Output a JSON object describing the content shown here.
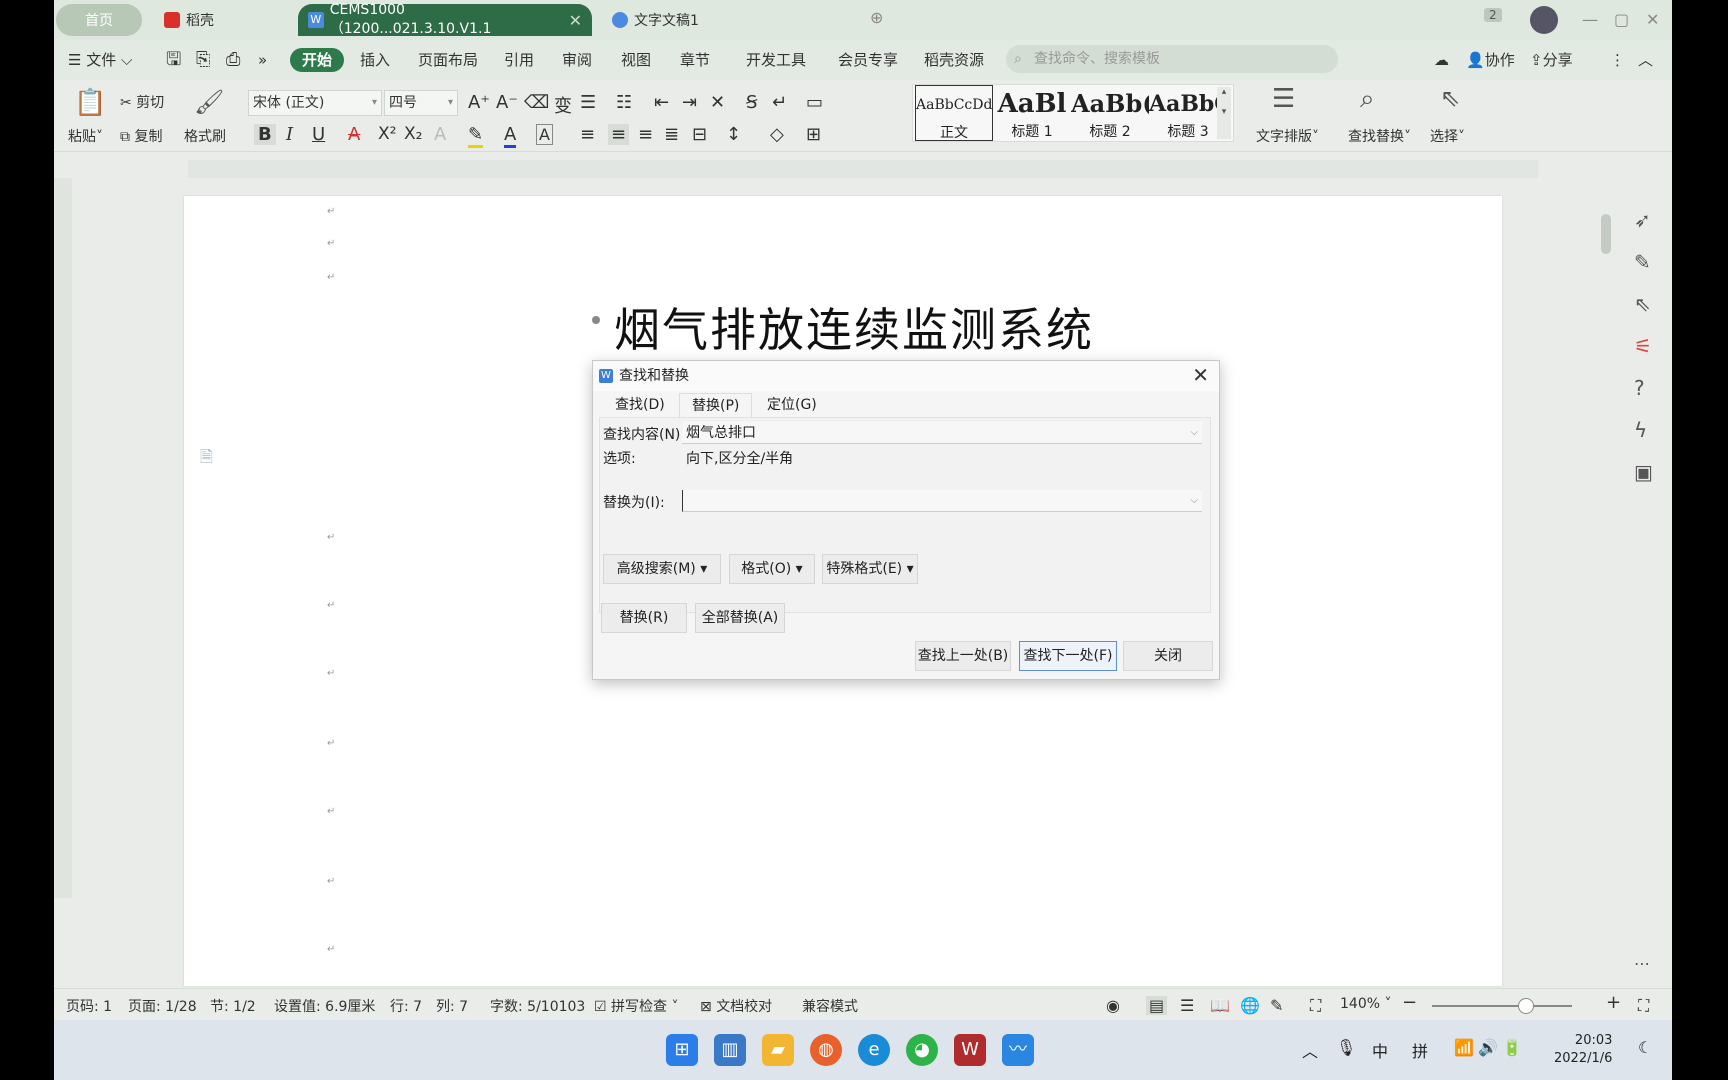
{
  "titlebar": {
    "home_tab": "首页",
    "app_tab": "稻壳",
    "doc_tab_active": "CEMS1000（1200...021.3.10.V1.1",
    "doc_tab_2": "文字文稿1",
    "badge": "2"
  },
  "menubar": {
    "file": "文件",
    "items": [
      "开始",
      "插入",
      "页面布局",
      "引用",
      "审阅",
      "视图",
      "章节",
      "开发工具",
      "会员专享",
      "稻壳资源"
    ],
    "search_placeholder": "查找命令、搜索模板",
    "collab": "协作",
    "share": "分享"
  },
  "ribbon": {
    "paste": "粘贴",
    "cut": "剪切",
    "copy": "复制",
    "format_painter": "格式刷",
    "font_name": "宋体 (正文)",
    "font_size": "四号",
    "styles": [
      {
        "preview": "AaBbCcDd",
        "label": "正文"
      },
      {
        "preview": "AaBl",
        "label": "标题 1"
      },
      {
        "preview": "AaBb(",
        "label": "标题 2"
      },
      {
        "preview": "AaBbC",
        "label": "标题 3"
      }
    ],
    "text_layout": "文字排版",
    "find_replace": "查找替换",
    "select": "选择"
  },
  "document": {
    "title": "烟气排放连续监测系统"
  },
  "dialog": {
    "title": "查找和替换",
    "tabs": [
      "查找(D)",
      "替换(P)",
      "定位(G)"
    ],
    "active_tab": "替换(P)",
    "find_label": "查找内容(N):",
    "find_value": "烟气总排口",
    "options_label": "选项:",
    "options_value": "向下,区分全/半角",
    "replace_label": "替换为(I):",
    "replace_value": "",
    "advanced": "高级搜索(M)",
    "format": "格式(O)",
    "special": "特殊格式(E)",
    "replace_btn": "替换(R)",
    "replace_all_btn": "全部替换(A)",
    "find_prev": "查找上一处(B)",
    "find_next": "查找下一处(F)",
    "close": "关闭"
  },
  "statusbar": {
    "page_code": "页码: 1",
    "page": "页面: 1/28",
    "section": "节: 1/2",
    "setting": "设置值: 6.9厘米",
    "row": "行: 7",
    "col": "列: 7",
    "word_count": "字数: 5/10103",
    "spell": "拼写检查",
    "proof": "文档校对",
    "compat": "兼容模式",
    "zoom": "140%"
  },
  "taskbar": {
    "ime_zh": "中",
    "ime_py": "拼",
    "time": "20:03",
    "date": "2022/1/6"
  }
}
